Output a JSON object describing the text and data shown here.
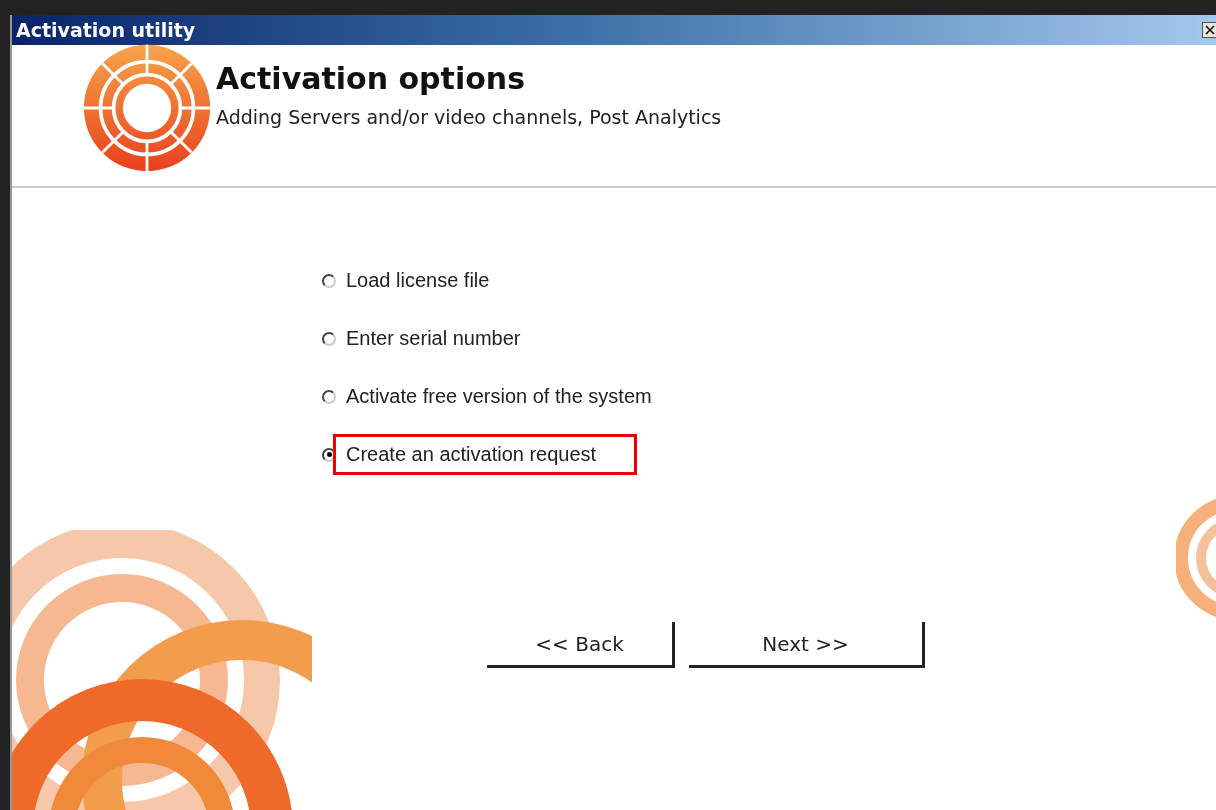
{
  "window": {
    "title": "Activation utility"
  },
  "header": {
    "title": "Activation options",
    "subtitle": "Adding Servers and/or video channels, Post Analytics"
  },
  "options": [
    {
      "label": "Load license file",
      "selected": false,
      "highlighted": false
    },
    {
      "label": "Enter serial number",
      "selected": false,
      "highlighted": false
    },
    {
      "label": "Activate free version of the system",
      "selected": false,
      "highlighted": false
    },
    {
      "label": "Create an activation request",
      "selected": true,
      "highlighted": true
    }
  ],
  "buttons": [
    {
      "label": "<< Back"
    },
    {
      "label": "Next >>"
    }
  ]
}
